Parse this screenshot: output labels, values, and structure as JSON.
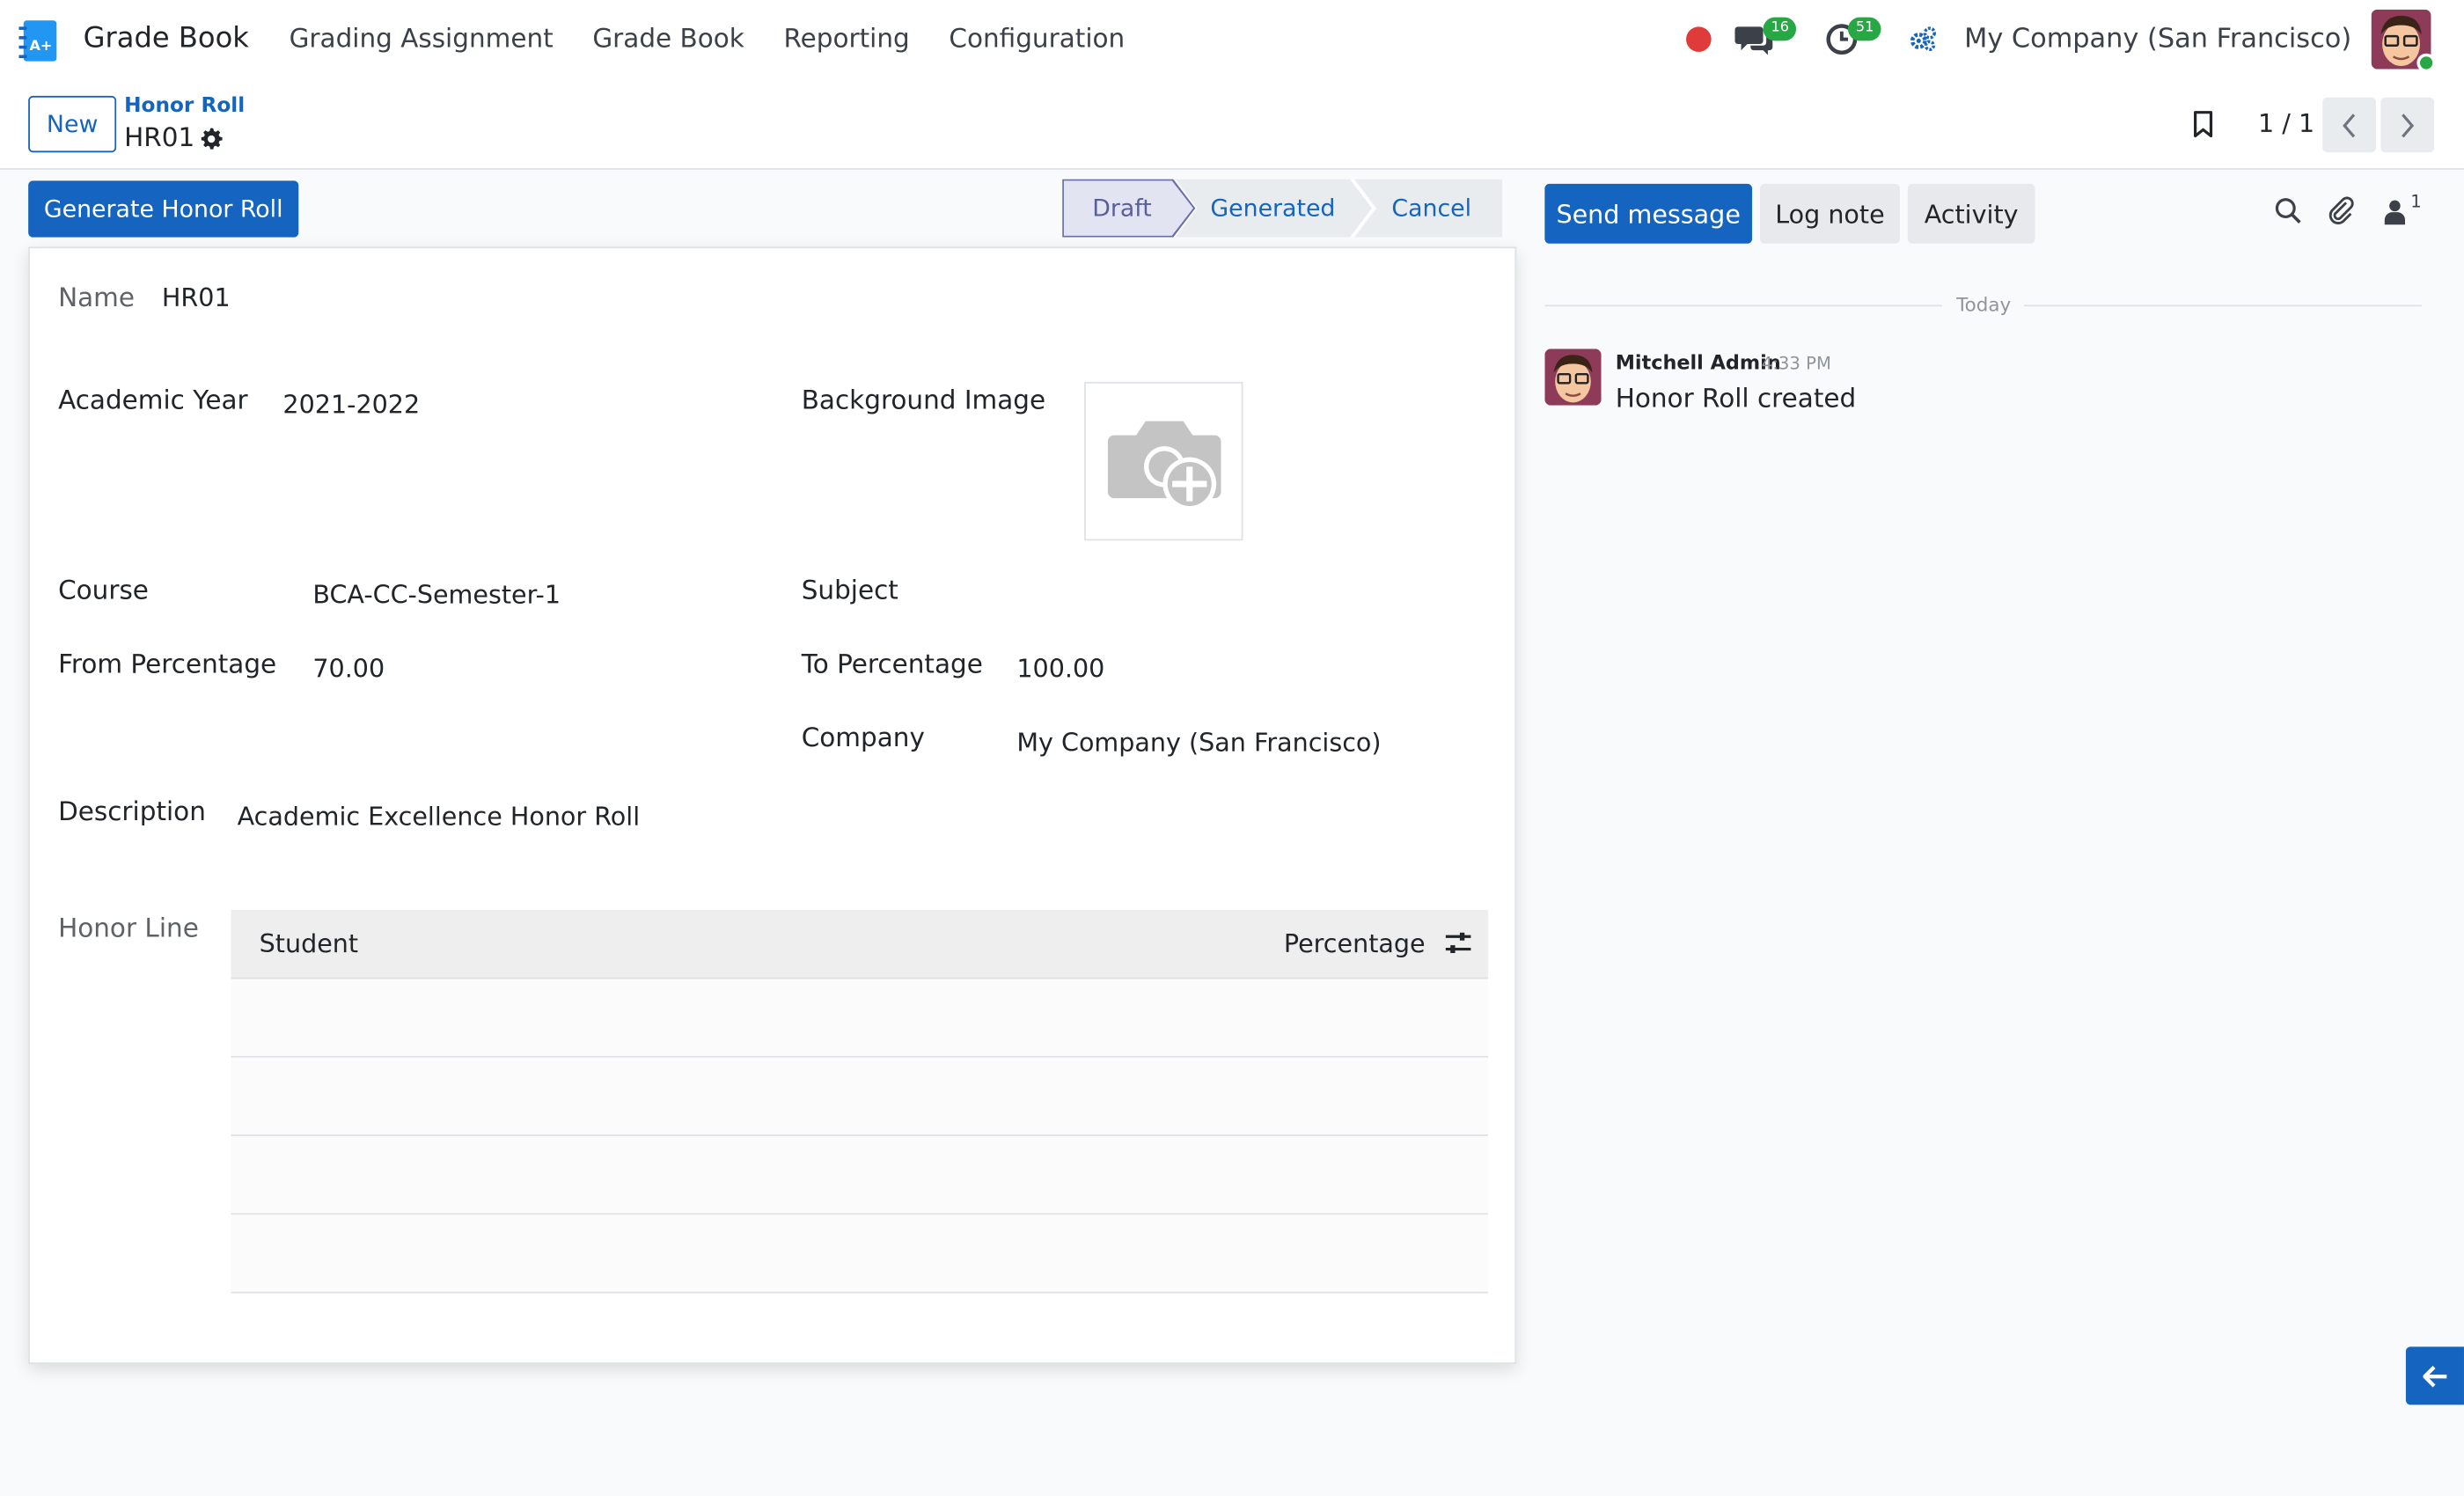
{
  "navbar": {
    "app_name": "Grade Book",
    "menu": [
      "Grading Assignment",
      "Grade Book",
      "Reporting",
      "Configuration"
    ],
    "chat_count": "16",
    "activity_count": "51",
    "company": "My Company (San Francisco)"
  },
  "control": {
    "new_label": "New",
    "breadcrumb": "Honor Roll",
    "record": "HR01",
    "pager": "1 / 1"
  },
  "form": {
    "generate_label": "Generate Honor Roll",
    "status": [
      "Draft",
      "Generated",
      "Cancel"
    ],
    "active_status": "Draft",
    "fields": {
      "name_label": "Name",
      "name_value": "HR01",
      "year_label": "Academic Year",
      "year_value": "2021-2022",
      "bg_label": "Background Image",
      "course_label": "Course",
      "course_value": "BCA-CC-Semester-1",
      "subject_label": "Subject",
      "from_label": "From Percentage",
      "from_value": "70.00",
      "to_label": "To Percentage",
      "to_value": "100.00",
      "company_label": "Company",
      "company_value": "My Company (San Francisco)",
      "desc_label": "Description",
      "desc_value": "Academic Excellence Honor Roll",
      "honor_label": "Honor Line"
    },
    "table": {
      "col_student": "Student",
      "col_percentage": "Percentage"
    }
  },
  "chatter": {
    "send_label": "Send message",
    "log_label": "Log note",
    "activity_label": "Activity",
    "followers": "1",
    "today": "Today",
    "message": {
      "author": "Mitchell Admin",
      "time": "4:33 PM",
      "body": "Honor Roll created"
    }
  },
  "colors": {
    "primary": "#1565c0",
    "success": "#28a745",
    "danger": "#e03b3b"
  }
}
